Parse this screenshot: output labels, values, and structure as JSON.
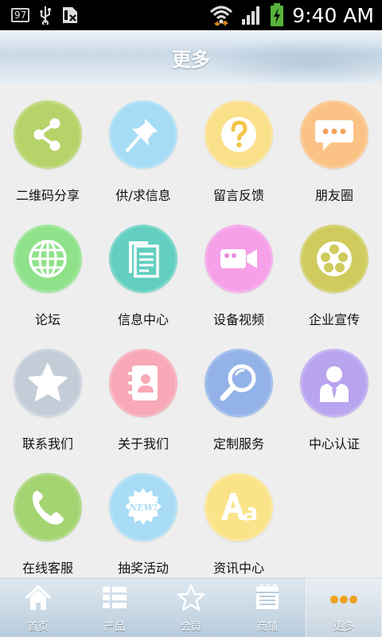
{
  "status_bar": {
    "badge": "97",
    "time": "9:40 AM"
  },
  "header": {
    "title": "更多"
  },
  "grid_items": [
    {
      "label": "二维码分享",
      "icon": "share-icon",
      "color": "#b6d36a"
    },
    {
      "label": "供/求信息",
      "icon": "pin-icon",
      "color": "#a6dcf5"
    },
    {
      "label": "留言反馈",
      "icon": "question-icon",
      "color": "#fbe08a"
    },
    {
      "label": "朋友圈",
      "icon": "chat-bubble-icon",
      "color": "#fbc286"
    },
    {
      "label": "论坛",
      "icon": "globe-icon",
      "color": "#8fe28a"
    },
    {
      "label": "信息中心",
      "icon": "documents-icon",
      "color": "#62cfc0"
    },
    {
      "label": "设备视频",
      "icon": "video-camera-icon",
      "color": "#f5a0e8"
    },
    {
      "label": "企业宣传",
      "icon": "film-reel-icon",
      "color": "#cfcb5c"
    },
    {
      "label": "联系我们",
      "icon": "star-icon",
      "color": "#c4ccd8"
    },
    {
      "label": "关于我们",
      "icon": "contact-book-icon",
      "color": "#f8a8b6"
    },
    {
      "label": "定制服务",
      "icon": "magnifier-icon",
      "color": "#92b2e8"
    },
    {
      "label": "中心认证",
      "icon": "person-tie-icon",
      "color": "#b9a4ef"
    },
    {
      "label": "在线客服",
      "icon": "phone-icon",
      "color": "#a4d472"
    },
    {
      "label": "抽奖活动",
      "icon": "new-badge-icon",
      "color": "#a7dcf4"
    },
    {
      "label": "资讯中心",
      "icon": "font-aa-icon",
      "color": "#fbe38a"
    }
  ],
  "bottom_nav": [
    {
      "label": "首页",
      "icon": "home-icon"
    },
    {
      "label": "产品",
      "icon": "grid-list-icon"
    },
    {
      "label": "会员",
      "icon": "star-outline-icon"
    },
    {
      "label": "商铺",
      "icon": "store-board-icon"
    },
    {
      "label": "更多",
      "icon": "more-dots-icon",
      "active": true
    }
  ]
}
